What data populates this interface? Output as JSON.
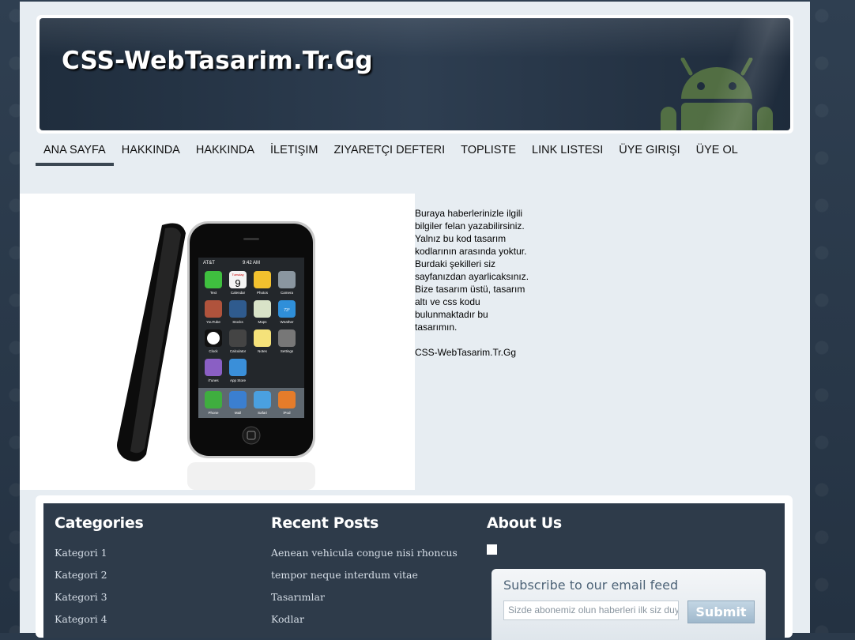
{
  "site": {
    "title": "CSS-WebTasarim.Tr.Gg"
  },
  "nav": {
    "items": [
      {
        "label": "ANA SAYFA"
      },
      {
        "label": "HAKKINDA"
      },
      {
        "label": "HAKKINDA"
      },
      {
        "label": "İLETIŞIM"
      },
      {
        "label": "ZIYARETÇI DEFTERI"
      },
      {
        "label": "TOPLISTE"
      },
      {
        "label": "LINK LISTESI"
      },
      {
        "label": "ÜYE GIRIŞI"
      },
      {
        "label": "ÜYE OL"
      }
    ]
  },
  "article": {
    "lines": [
      " Buraya haberlerinizle ilgili bilgiler felan yazabilirsiniz.",
      " Yalnız bu kod tasarım kodlarının arasında yoktur.",
      " Burdaki şekilleri siz sayfanızdan ayarlicaksınız.",
      " Bize tasarım üstü, tasarım altı ve css kodu bulunmaktadır bu tasarımın."
    ],
    "signature": "CSS-WebTasarim.Tr.Gg"
  },
  "phone": {
    "status_carrier": "AT&T",
    "status_time": "9:42 AM",
    "calendar_day": "Tuesday",
    "calendar_date": "9",
    "weather_temp": "73°",
    "apps": [
      "Text",
      "Calendar",
      "Photos",
      "Camera",
      "YouTube",
      "Stocks",
      "Maps",
      "Weather",
      "Clock",
      "Calculator",
      "Notes",
      "Settings",
      "iTunes",
      "App Store"
    ],
    "dock": [
      "Phone",
      "Mail",
      "Safari",
      "iPod"
    ]
  },
  "footer": {
    "categories": {
      "title": "Categories",
      "items": [
        "Kategori 1",
        "Kategori 2",
        "Kategori 3",
        "Kategori 4"
      ]
    },
    "recent_posts": {
      "title": "Recent Posts",
      "items": [
        "Aenean vehicula congue nisi rhoncus",
        "tempor neque interdum vitae",
        "Tasarımlar",
        "Kodlar"
      ]
    },
    "about": {
      "title": "About Us"
    },
    "subscribe": {
      "title": "Subscribe to our email feed",
      "input_value": "Sizde abonemiz olun haberleri ilk siz duyun",
      "button_label": "Submit"
    }
  }
}
